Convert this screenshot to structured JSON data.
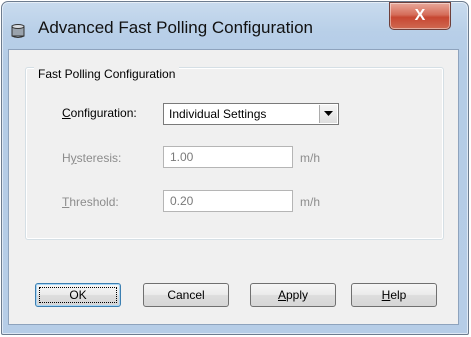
{
  "window": {
    "title": "Advanced Fast Polling Configuration",
    "title_icon": "database-cylinder-icon",
    "close_label": "X"
  },
  "group": {
    "title": "Fast Polling Configuration"
  },
  "configuration": {
    "label_mnemonic": "C",
    "label_rest": "onfiguration:",
    "selected": "Individual Settings",
    "arrow_icon": "chevron-down-icon"
  },
  "hysteresis": {
    "label_pre": "H",
    "label_mnemonic": "y",
    "label_rest": "steresis:",
    "value": "1.00",
    "unit": "m/h"
  },
  "threshold": {
    "label_mnemonic": "T",
    "label_rest": "hreshold:",
    "value": "0.20",
    "unit": "m/h"
  },
  "buttons": {
    "ok": "OK",
    "cancel": "Cancel",
    "apply_mnemonic": "A",
    "apply_rest": "pply",
    "help_mnemonic": "H",
    "help_rest": "elp"
  },
  "colors": {
    "frame": "#b6cde7",
    "close_button": "#c74732",
    "dialog_bg": "#f0f0f0",
    "disabled_text": "#8c8c8c"
  }
}
